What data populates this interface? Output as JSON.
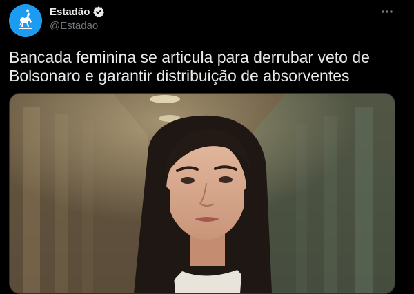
{
  "tweet": {
    "author": {
      "display_name": "Estadão",
      "handle": "@Estadao",
      "verified": true,
      "avatar_icon": "horse-rider-logo-icon"
    },
    "text": "Bancada feminina se articula para derrubar veto de\nBolsonaro e garantir distribuição de absorventes",
    "more_icon": "more-horizontal-icon",
    "media": {
      "kind": "photo",
      "subject": "woman-portrait-in-hallway"
    }
  },
  "colors": {
    "background": "#000000",
    "text_primary": "#e7e9ea",
    "text_secondary": "#71767b",
    "brand_blue": "#1d9bf0"
  }
}
